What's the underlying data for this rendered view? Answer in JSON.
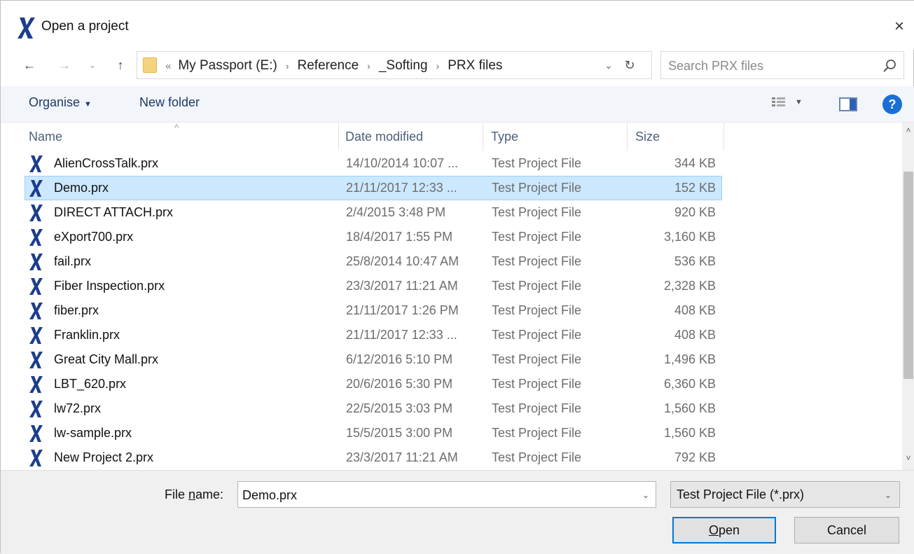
{
  "window": {
    "title": "Open a project",
    "close_symbol": "×"
  },
  "nav": {
    "back_symbol": "←",
    "forward_symbol": "→",
    "recent_symbol": "⌄",
    "up_symbol": "↑",
    "address_lead": "«",
    "breadcrumb": [
      "My Passport (E:)",
      "Reference",
      "_Softing",
      "PRX files"
    ],
    "breadcrumb_separator": "›",
    "address_dropdown_symbol": "⌄",
    "refresh_symbol": "↻",
    "search_placeholder": "Search PRX files"
  },
  "toolbar": {
    "organise_label": "Organise",
    "organise_caret": "▼",
    "new_folder_label": "New folder",
    "views_caret": "▼",
    "help_label": "?"
  },
  "columns": {
    "name": "Name",
    "date_modified": "Date modified",
    "type": "Type",
    "size": "Size",
    "sort_indicator": "^"
  },
  "files": [
    {
      "name": "AlienCrossTalk.prx",
      "date": "14/10/2014 10:07 ...",
      "type": "Test Project File",
      "size": "344 KB"
    },
    {
      "name": "Demo.prx",
      "date": "21/11/2017 12:33 ...",
      "type": "Test Project File",
      "size": "152 KB",
      "selected": true
    },
    {
      "name": "DIRECT ATTACH.prx",
      "date": "2/4/2015 3:48 PM",
      "type": "Test Project File",
      "size": "920 KB"
    },
    {
      "name": "eXport700.prx",
      "date": "18/4/2017 1:55 PM",
      "type": "Test Project File",
      "size": "3,160 KB"
    },
    {
      "name": "fail.prx",
      "date": "25/8/2014 10:47 AM",
      "type": "Test Project File",
      "size": "536 KB"
    },
    {
      "name": "Fiber Inspection.prx",
      "date": "23/3/2017 11:21 AM",
      "type": "Test Project File",
      "size": "2,328 KB"
    },
    {
      "name": "fiber.prx",
      "date": "21/11/2017 1:26 PM",
      "type": "Test Project File",
      "size": "408 KB"
    },
    {
      "name": "Franklin.prx",
      "date": "21/11/2017 12:33 ...",
      "type": "Test Project File",
      "size": "408 KB"
    },
    {
      "name": "Great City Mall.prx",
      "date": "6/12/2016 5:10 PM",
      "type": "Test Project File",
      "size": "1,496 KB"
    },
    {
      "name": "LBT_620.prx",
      "date": "20/6/2016 5:30 PM",
      "type": "Test Project File",
      "size": "6,360 KB"
    },
    {
      "name": "lw72.prx",
      "date": "22/5/2015 3:03 PM",
      "type": "Test Project File",
      "size": "1,560 KB"
    },
    {
      "name": "lw-sample.prx",
      "date": "15/5/2015 3:00 PM",
      "type": "Test Project File",
      "size": "1,560 KB"
    },
    {
      "name": "New Project 2.prx",
      "date": "23/3/2017 11:21 AM",
      "type": "Test Project File",
      "size": "792 KB"
    }
  ],
  "scrollbar": {
    "up_symbol": "˄",
    "down_symbol": "˅"
  },
  "footer": {
    "file_name_label_pre": "File ",
    "file_name_label_key": "n",
    "file_name_label_post": "ame:",
    "file_name_value": "Demo.prx",
    "file_name_dropdown_symbol": "⌄",
    "file_type_value": "Test Project File (*.prx)",
    "file_type_dropdown_symbol": "⌄",
    "open_key": "O",
    "open_rest": "pen",
    "cancel_label": "Cancel"
  },
  "colors": {
    "app_icon": "#1c3d8c",
    "selection_bg": "#cce8ff",
    "selection_border": "#99d1ff",
    "accent": "#0078d7",
    "help_icon": "#1a6fd6"
  }
}
